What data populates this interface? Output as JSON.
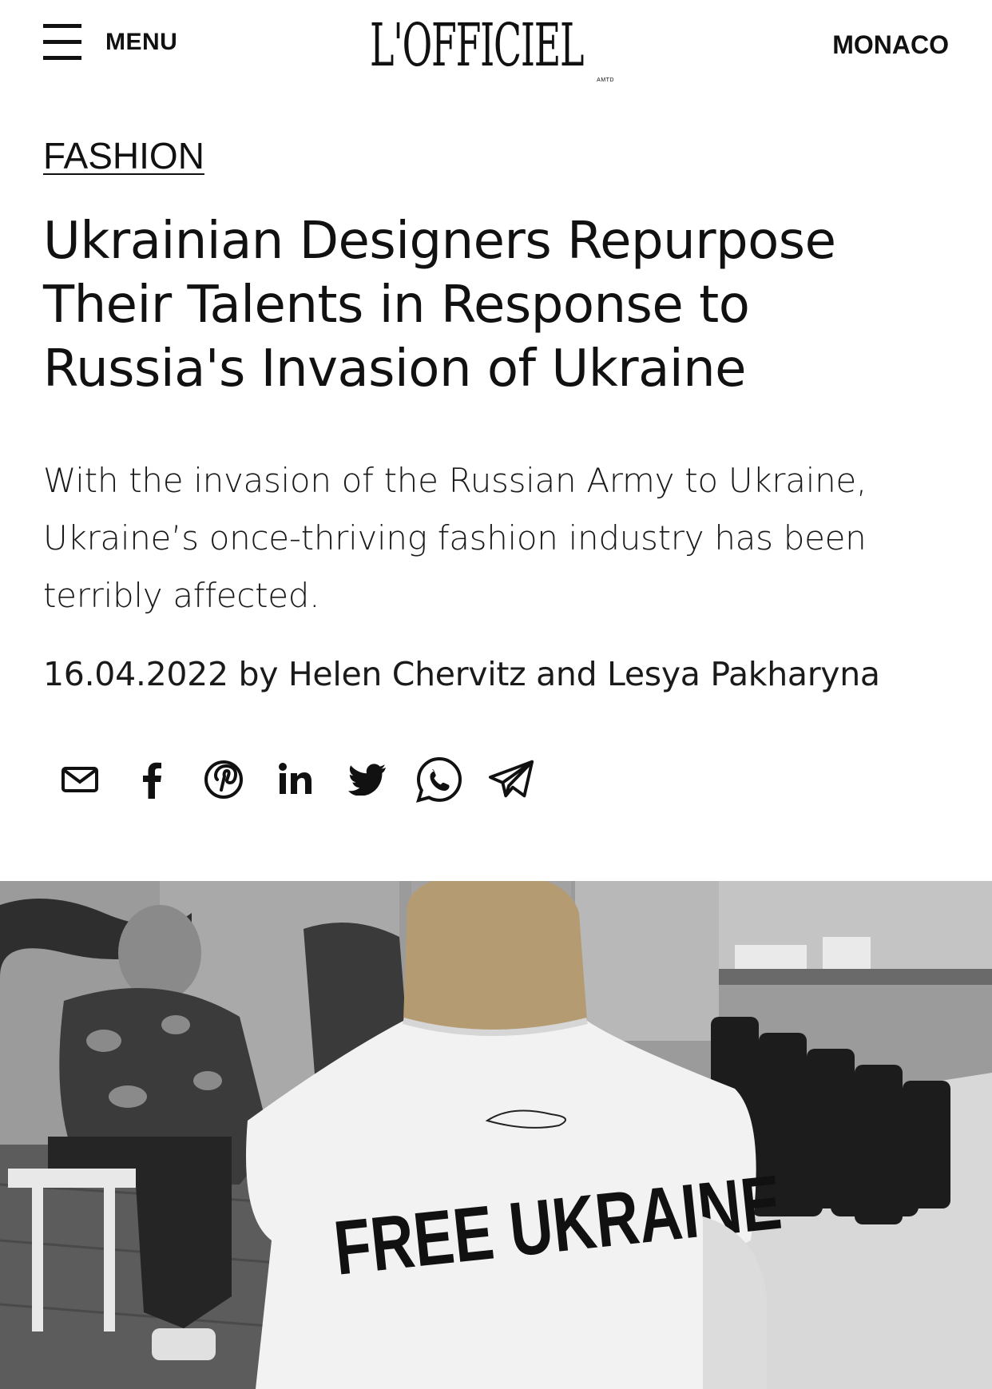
{
  "header": {
    "menu_label": "MENU",
    "logo_text": "L'OFFICIEL",
    "logo_sub": "AMTD",
    "region": "MONACO"
  },
  "article": {
    "category": "FASHION",
    "title": "Ukrainian Designers Repurpose Their Talents in Response to Russia's Invasion of Ukraine",
    "lead": "With the invasion of the Russian Army to Ukraine, Ukraine’s once-thriving fashion industry has been terribly affected.",
    "meta": "16.04.2022 by Helen Chervitz and Lesya Pakharyna"
  },
  "share_icons": [
    "email-icon",
    "facebook-icon",
    "pinterest-icon",
    "linkedin-icon",
    "twitter-icon",
    "whatsapp-icon",
    "telegram-icon"
  ],
  "hero": {
    "shirt_text": "FREE UKRAINE",
    "colors": {
      "background": "#8c8c8c",
      "shirt": "#f2f2f2",
      "ink": "#111111"
    }
  }
}
